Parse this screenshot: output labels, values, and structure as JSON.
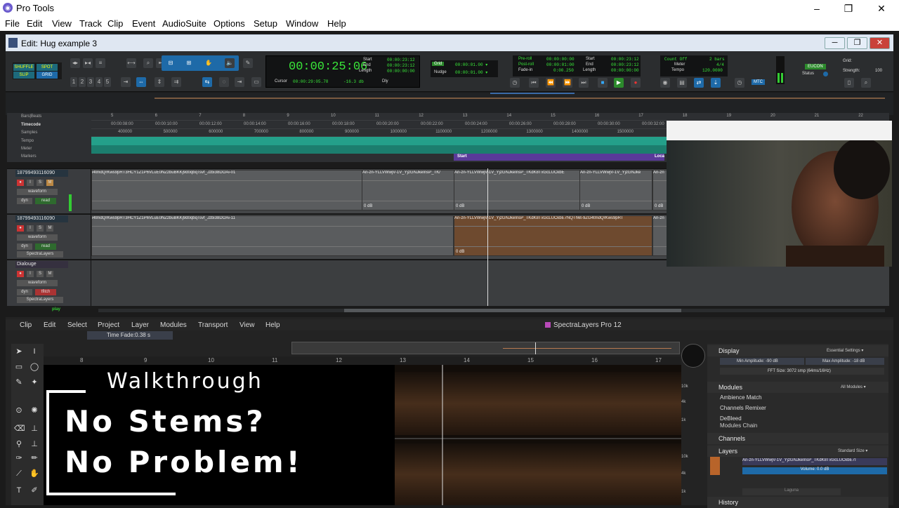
{
  "titlebar": {
    "title": "Pro Tools",
    "minimize": "–",
    "maximize": "❐",
    "close": "✕"
  },
  "menubar": [
    "File",
    "Edit",
    "View",
    "Track",
    "Clip",
    "Event",
    "AudioSuite",
    "Options",
    "Setup",
    "Window",
    "Help"
  ],
  "edit_window": {
    "title": "Edit: Hug example 3"
  },
  "toolbar": {
    "modes": [
      "SHUFFLE",
      "SPOT",
      "SLIP",
      "GRID"
    ],
    "zoom_presets": [
      "1",
      "2",
      "3",
      "4",
      "5"
    ],
    "main_counter": "00:00:25:06",
    "start_label": "Start",
    "end_label": "End",
    "length_label": "Length",
    "start": "00:00:23:12",
    "end": "00:00:23:12",
    "length": "00:00:00:00",
    "cursor_label": "Cursor",
    "cursor": "00:00:29:05.78",
    "cursor_db": "-16.3 db",
    "dly": "Dly",
    "grid_label": "Grid",
    "grid_value": "00:00:01.00 ▾",
    "nudge_label": "Nudge",
    "nudge_value": "00:00:01.00 ▾",
    "preroll_label": "Pre-roll",
    "postroll_label": "Post-roll",
    "fadein_label": "Fade-in",
    "preroll": "00:00:00:00",
    "postroll": "00:00:01:00",
    "fadein": "0:00.250",
    "start2": "00:00:23:12",
    "end2": "00:00:23:12",
    "length2": "00:00:00:00",
    "countoff": "Count Off",
    "bars": "2 bars",
    "meter_label": "Meter",
    "meter": "4/4",
    "tempo_label": "Tempo",
    "tempo": "120.0000",
    "eucon": "EUCON",
    "status_label": "Status",
    "grid2_label": "Grid:",
    "strength_label": "Strength:",
    "strength": "100",
    "mtc": "MTC"
  },
  "rulers": {
    "labels": [
      "Bars|Beats",
      "Timecode",
      "Samples",
      "Tempo",
      "Meter",
      "Markers"
    ],
    "bars": [
      "5",
      "6",
      "7",
      "8",
      "9",
      "10",
      "11",
      "12",
      "13",
      "14",
      "15",
      "16",
      "17",
      "18",
      "19",
      "20",
      "21",
      "22"
    ],
    "timecode": [
      "00:00:08:00",
      "00:00:10:00",
      "00:00:12:00",
      "00:00:14:00",
      "00:00:16:00",
      "00:00:18:00",
      "00:00:20:00",
      "00:00:22:00",
      "00:00:24:00",
      "00:00:26:00",
      "00:00:28:00",
      "00:00:30:00",
      "00:00:32:00"
    ],
    "samples": [
      "400000",
      "500000",
      "600000",
      "700000",
      "800000",
      "900000",
      "1000000",
      "1100000",
      "1200000",
      "1300000",
      "1400000",
      "1500000"
    ],
    "marker_start": "Start",
    "marker_loc": "Loca"
  },
  "tracks": [
    {
      "name": "18799493116090",
      "view": "waveform",
      "dyn": "dyn",
      "mode": "read",
      "clips": [
        {
          "label": "i4tmdQrKws9pRT3HCY1Z1P6VLuE0NZzbuBKKj9d0qbqTsvf_Jzbi38DOAi-01"
        },
        {
          "label": "An-zn-YLLVWwjV-1V_YjzGNJkeInsP_TK/"
        },
        {
          "label": "An-zn-YLLVWwjV-1V_YjzGNJkeInsP_TKdK8TxGcLUCkbE"
        },
        {
          "label": "An-zn-YLLVWwjV-1V_YjzGNJke"
        },
        {
          "label": "An-zn"
        }
      ],
      "gains": [
        "0 dB",
        "0 dB",
        "0 dB",
        "0 dB"
      ]
    },
    {
      "name": "18799493116090",
      "view": "waveform",
      "dyn": "dyn",
      "mode": "read",
      "plugin": "SpectraLayers",
      "clips": [
        {
          "label": "i4tmdQrKws9pRT3HCY1Z1P6VLuE0NZzbuBKKj9d0qbqTsvf_Jzbi38DOAi-11"
        },
        {
          "label": "An-zn-YLLVWwjV-1V_YjzGNJkeInsP_TKdK8TxGcLUCkbE7NQTh6t-9ZG4tmdQrKws9pRT"
        },
        {
          "label": "An-zn"
        }
      ],
      "gains": [
        "0 dB"
      ]
    },
    {
      "name": "Dialouge",
      "view": "waveform",
      "dyn": "dyn",
      "mode": "tfitch",
      "plugin": "SpectraLayers"
    }
  ],
  "scroll": {
    "play": "play"
  },
  "spectral": {
    "menu": [
      "Clip",
      "Edit",
      "Select",
      "Project",
      "Layer",
      "Modules",
      "Transport",
      "View",
      "Help"
    ],
    "app_title": "SpectraLayers Pro 12",
    "time_fade_label": "Time Fade:",
    "time_fade_value": "0.38 s",
    "ruler": [
      "8",
      "9",
      "10",
      "11",
      "12",
      "13",
      "14",
      "15",
      "16",
      "17"
    ],
    "freq": [
      "10k",
      "4k",
      "1k",
      "10k",
      "4k",
      "1k"
    ],
    "panel": {
      "display": "Display",
      "essential": "Essential Settings ▾",
      "min_amp": "Min Amplitude: -90 dB",
      "max_amp": "Max Amplitude: -18 dB",
      "fft": "FFT Size: 3072 smp (64ms/16Hz)",
      "modules": "Modules",
      "all_modules": "All Modules ▾",
      "module_items": [
        "Ambience Match",
        "Channels Remixer",
        "DeBleed"
      ],
      "modules_chain": "Modules Chain",
      "channels": "Channels",
      "layers": "Layers",
      "standard_size": "Standard Size ▾",
      "layer_name": "An-zn-YLLVWwjV-1V_YjzGNJkeInsP_TKdK8TxGcLUCkbE7I",
      "volume": "Volume: 0.0 dB",
      "laguna": "Laguna",
      "history": "History"
    }
  },
  "overlay": {
    "line1": "Walkthrough",
    "line2": "No Stems?",
    "line3": "No Problem!"
  }
}
